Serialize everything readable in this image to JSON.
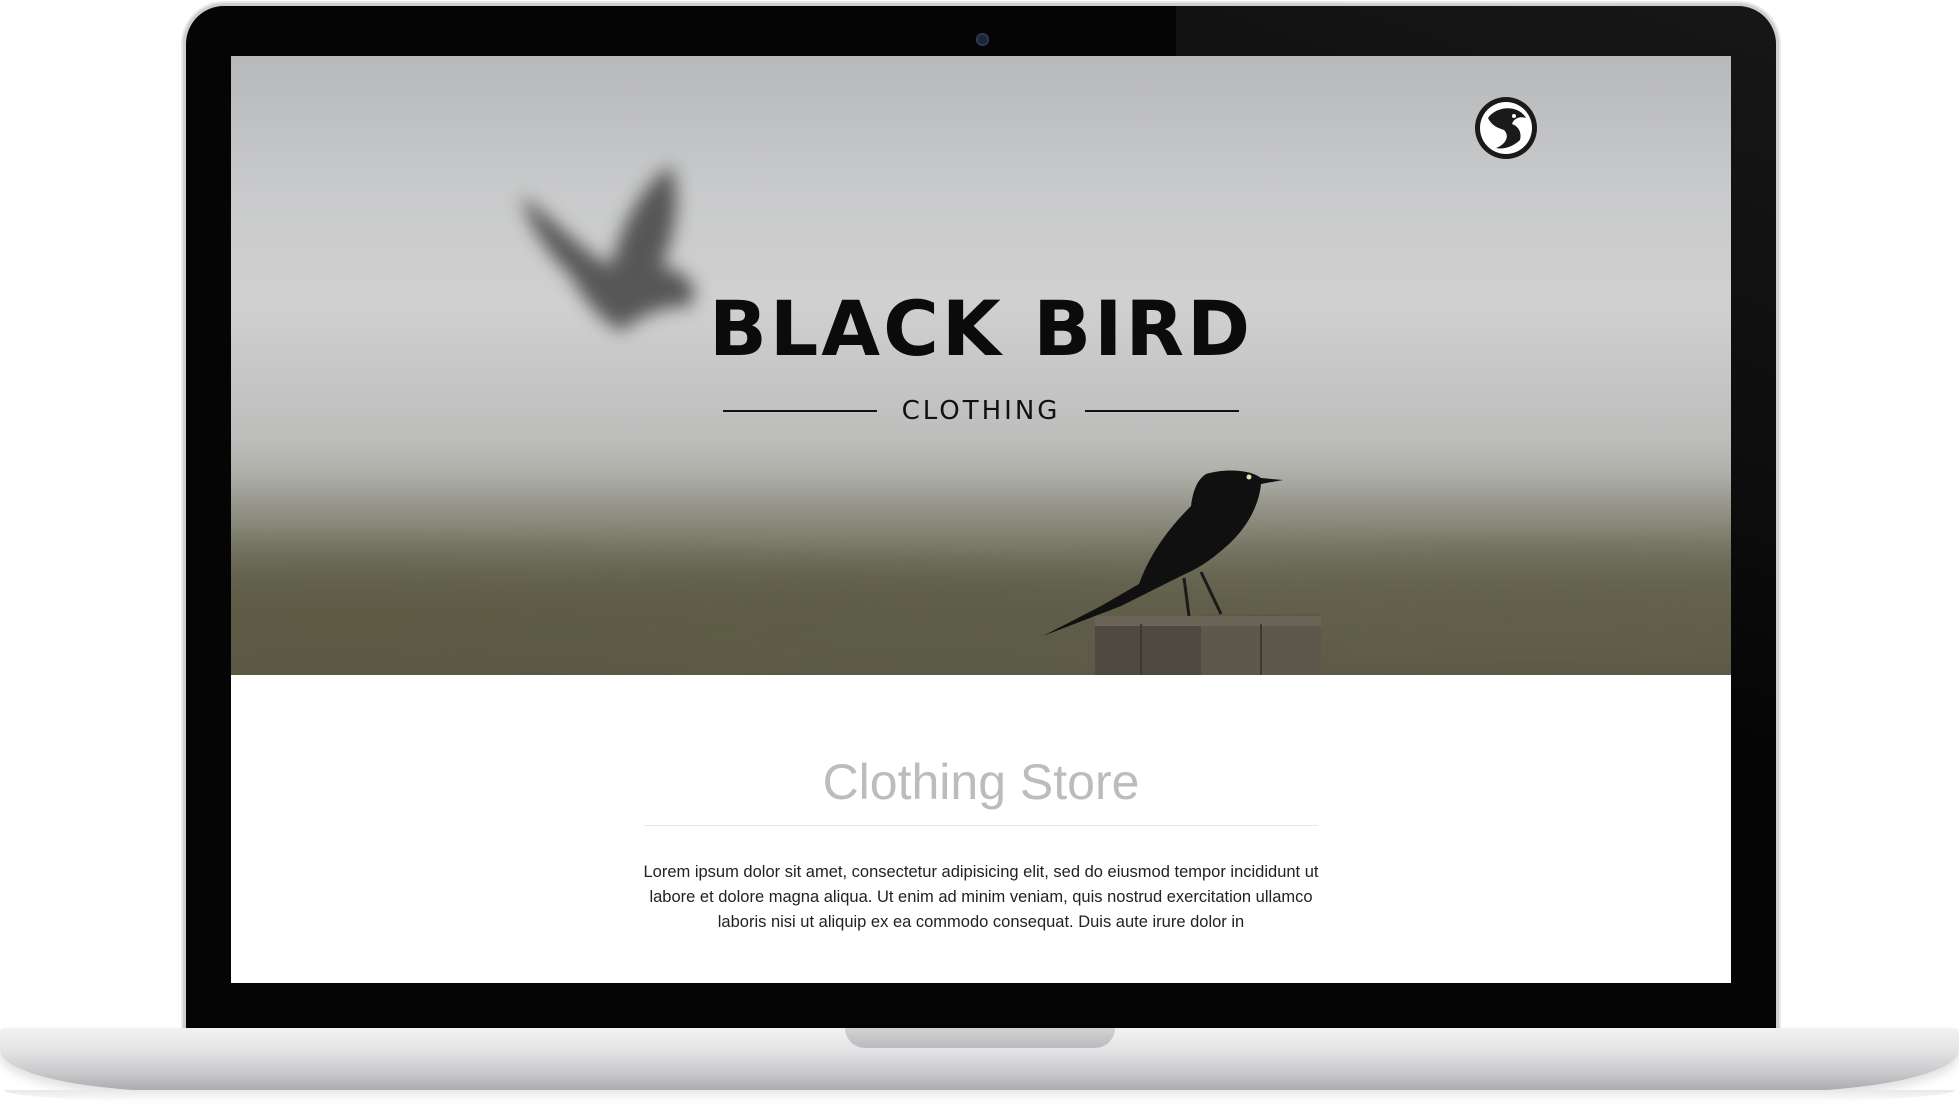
{
  "hero": {
    "title": "BLACK BIRD",
    "subtitle": "CLOTHING",
    "logo_icon": "bird-head-logo-icon"
  },
  "content": {
    "heading": "Clothing Store",
    "body": "Lorem ipsum dolor sit amet, consectetur adipisicing elit, sed do eiusmod tempor incididunt ut labore et dolore magna aliqua. Ut enim ad minim veniam, quis nostrud exercitation ullamco laboris nisi ut aliquip ex ea commodo consequat. Duis aute irure dolor in"
  },
  "colors": {
    "heading_gray": "#bcbcbc",
    "title_black": "#0b0b0b",
    "laptop_bezel": "#050505"
  }
}
